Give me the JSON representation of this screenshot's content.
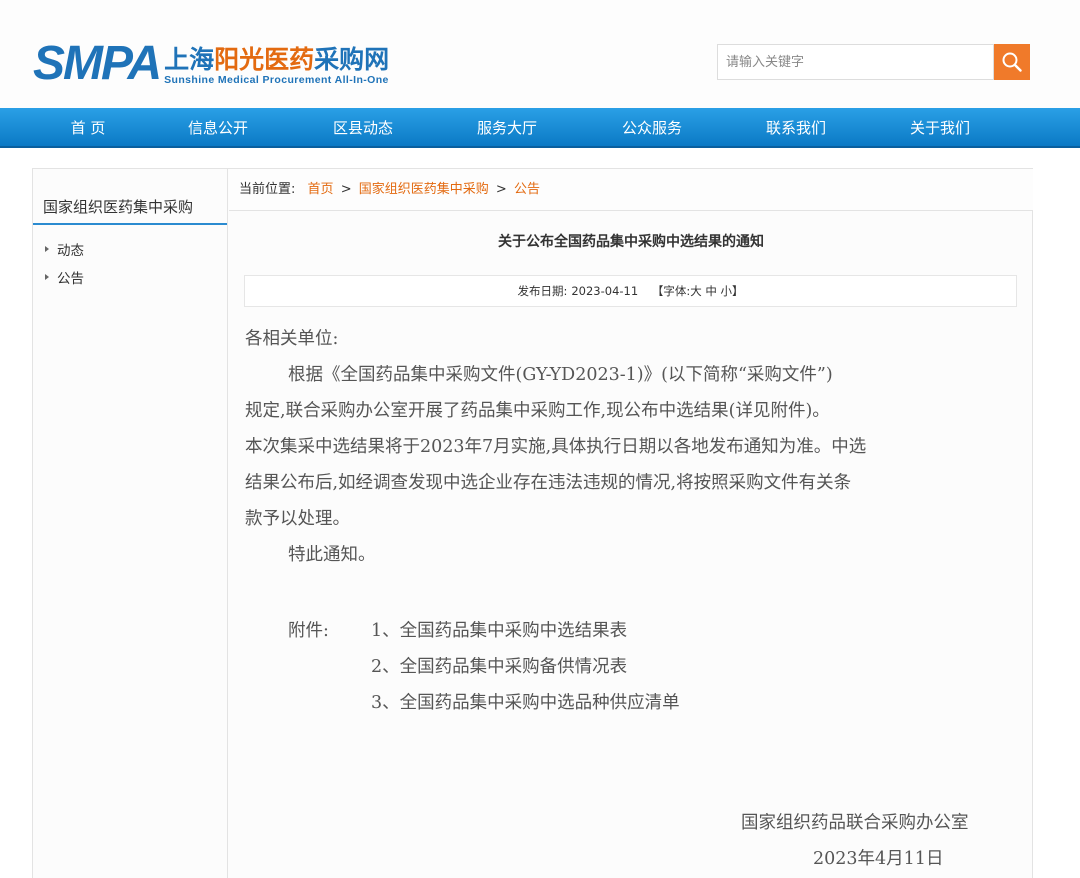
{
  "header": {
    "logo_smpa": "SMPA",
    "logo_cn_part1": "上海",
    "logo_cn_part2": "阳光",
    "logo_cn_part3": "医药",
    "logo_cn_part4": "采购网",
    "logo_en": "Sunshine Medical Procurement All-In-One",
    "search_placeholder": "请输入关键字",
    "colors": {
      "brand_blue": "#1f73b8",
      "brand_orange": "#e36a10"
    }
  },
  "nav": {
    "items": [
      "首 页",
      "信息公开",
      "区县动态",
      "服务大厅",
      "公众服务",
      "联系我们",
      "关于我们"
    ]
  },
  "sidebar": {
    "title": "国家组织医药集中采购",
    "items": [
      "动态",
      "公告"
    ]
  },
  "breadcrumb": {
    "label": "当前位置:",
    "home": "首页",
    "section": "国家组织医药集中采购",
    "current": "公告",
    "separator": ">"
  },
  "article": {
    "title": "关于公布全国药品集中采购中选结果的通知",
    "date_label": "发布日期:",
    "date": "2023-04-11",
    "font_size_label": "【字体:",
    "font_large": "大",
    "font_medium": "中",
    "font_small": "小",
    "font_close": "】",
    "greeting": "各相关单位:",
    "paragraph_lines": [
      "根据《全国药品集中采购文件(GY-YD2023-1)》(以下简称“采购文件”)",
      "规定,联合采购办公室开展了药品集中采购工作,现公布中选结果(详见附件)。",
      "本次集采中选结果将于2023年7月实施,具体执行日期以各地发布通知为准。中选",
      "结果公布后,如经调查发现中选企业存在违法违规的情况,将按照采购文件有关条",
      "款予以处理。"
    ],
    "closing": "特此通知。",
    "attachments_label": "附件:",
    "attachments": [
      "1、全国药品集中采购中选结果表",
      "2、全国药品集中采购备供情况表",
      "3、全国药品集中采购中选品种供应清单"
    ],
    "signature": "国家组织药品联合采购办公室",
    "signature_date": "2023年4月11日"
  }
}
